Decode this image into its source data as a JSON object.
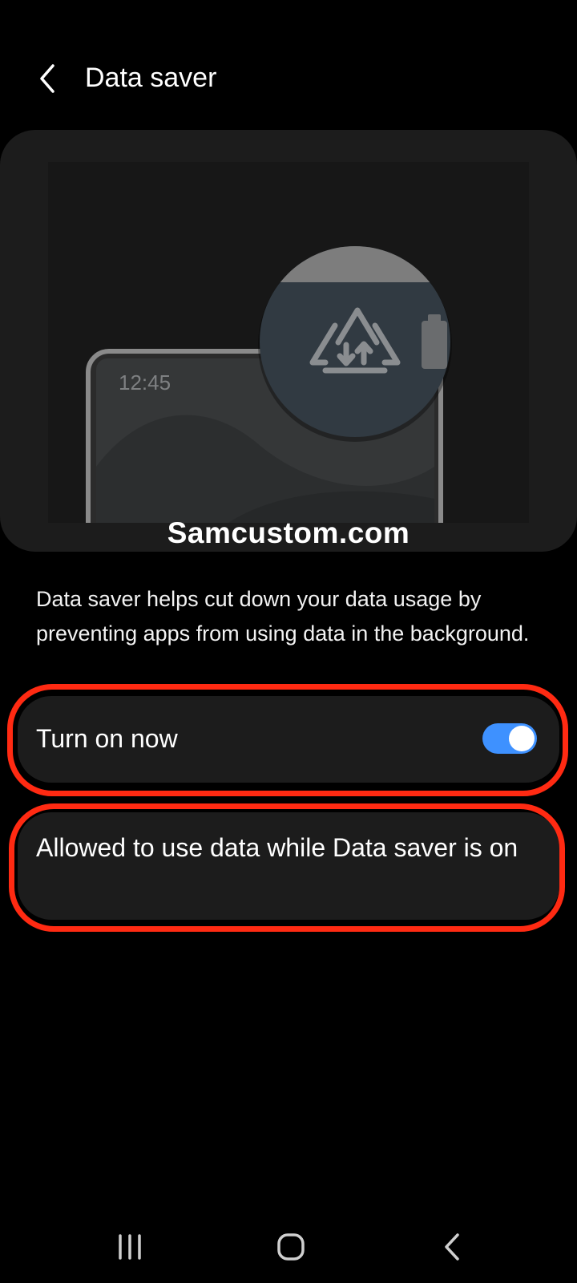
{
  "header": {
    "title": "Data saver",
    "back_icon": "chevron-left-icon"
  },
  "illustration": {
    "clock": "12:45",
    "center_icon": "data-saver-icon",
    "side_icon": "battery-icon",
    "watermark": "Samcustom.com"
  },
  "description": "Data saver helps cut down your data usage by preventing apps from using data in the background.",
  "settings": {
    "turn_on_label": "Turn on now",
    "turn_on_state": true,
    "allowed_label": "Allowed to use data while Data saver is on"
  },
  "navbar": {
    "recents_icon": "recents-icon",
    "home_icon": "home-icon",
    "back_icon": "nav-back-icon"
  },
  "colors": {
    "accent": "#3e91ff",
    "highlight": "#ff2a12",
    "card": "#1c1c1c",
    "background": "#000000"
  }
}
